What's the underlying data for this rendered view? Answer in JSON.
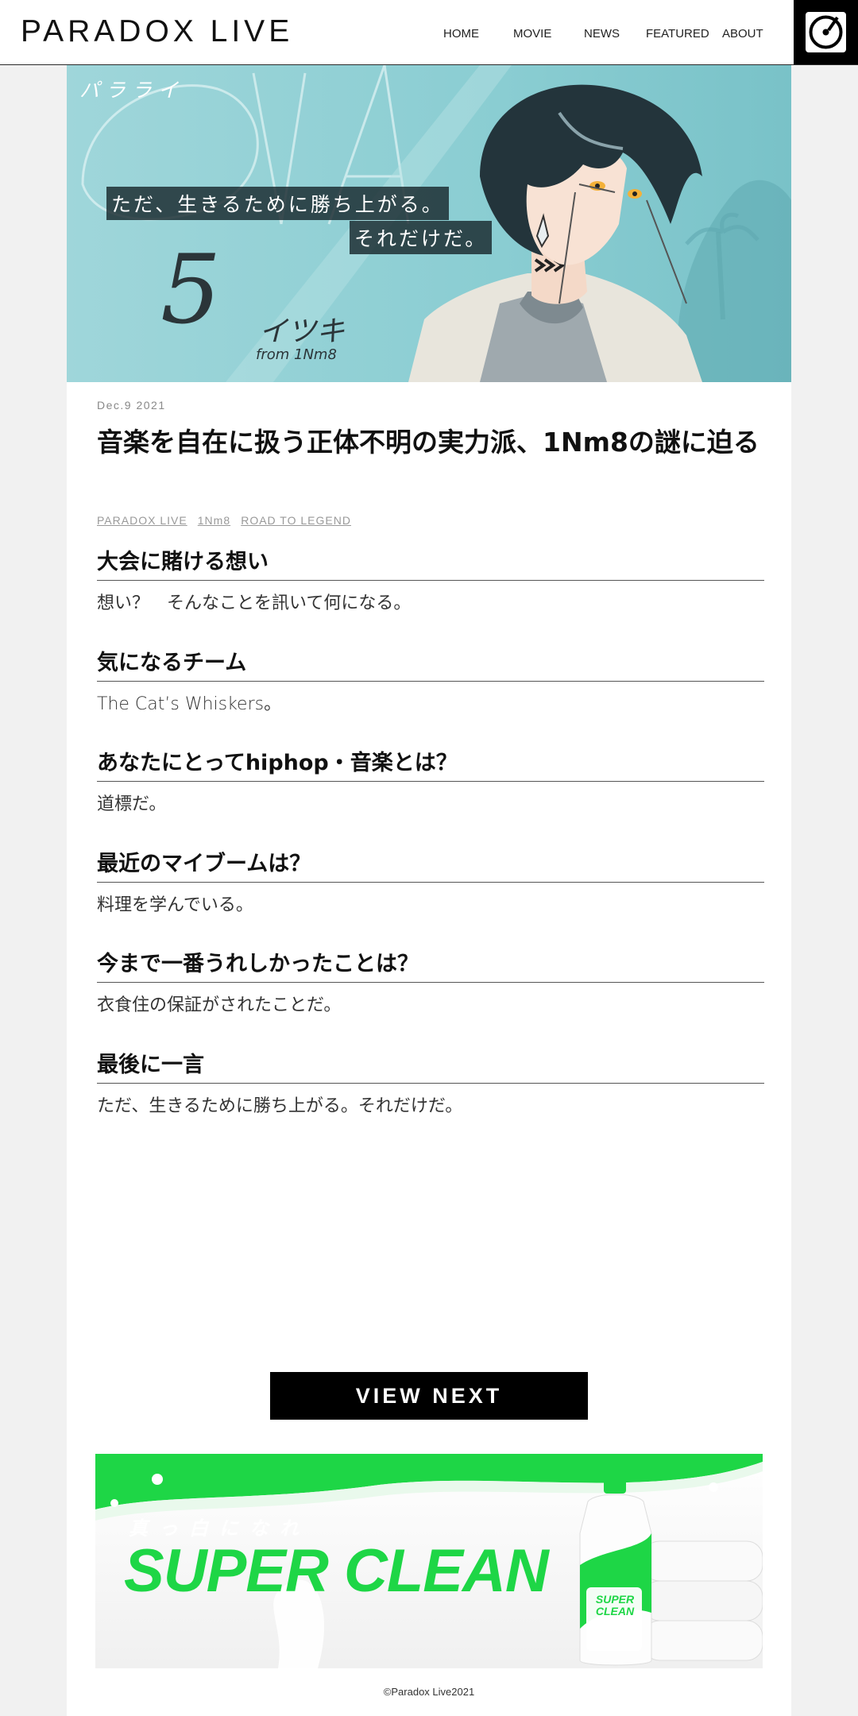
{
  "header": {
    "logo": "PARADOX LIVE",
    "nav": [
      "HOME",
      "MOVIE",
      "NEWS",
      "FEATURED",
      "ABOUT"
    ]
  },
  "hero": {
    "catch_line1": "ただ、生きるために勝ち上がる。",
    "catch_line2": "それだけだ。",
    "number": "5",
    "name": "イツキ",
    "team": "from 1Nm8",
    "tagline": "パラライ"
  },
  "article": {
    "date": "Dec.9 2021",
    "title": "音楽を自在に扱う正体不明の実力派、1Nm8の謎に迫る",
    "tags": [
      "PARADOX LIVE",
      "1Nm8",
      "ROAD TO LEGEND"
    ],
    "qa": [
      {
        "q": "大会に賭ける想い",
        "a": "想い？　そんなことを訊いて何になる。"
      },
      {
        "q": "気になるチーム",
        "a": "The Cat’s Whiskers。"
      },
      {
        "q": "あなたにとってhiphop・音楽とは？",
        "a": "道標だ。"
      },
      {
        "q": "最近のマイブームは？",
        "a": "料理を学んでいる。"
      },
      {
        "q": "今まで一番うれしかったことは？",
        "a": "衣食住の保証がされたことだ。"
      },
      {
        "q": "最後に一言",
        "a": "ただ、生きるために勝ち上がる。それだけだ。"
      }
    ]
  },
  "view_next": "VIEW NEXT",
  "ad": {
    "sub": "真っ白になれ",
    "main": "SUPER CLEAN",
    "bottle_label": "SUPER CLEAN",
    "accent": "#1ed646"
  },
  "footer": {
    "copyright": "©Paradox Live2021"
  }
}
